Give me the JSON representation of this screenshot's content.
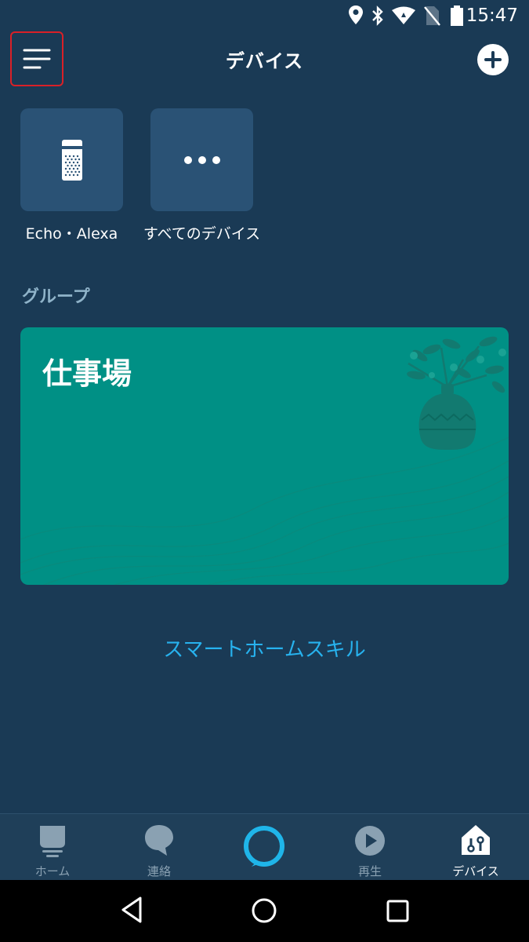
{
  "status_bar": {
    "time": "15:47",
    "icons": [
      "location-icon",
      "bluetooth-icon",
      "wifi-icon",
      "no-sim-icon",
      "battery-icon"
    ]
  },
  "header": {
    "title": "デバイス",
    "menu_icon": "hamburger-menu-icon",
    "add_icon": "plus-icon"
  },
  "device_tiles": [
    {
      "label": "Echo・Alexa",
      "icon": "echo-speaker-icon"
    },
    {
      "label": "すべてのデバイス",
      "icon": "more-dots-icon"
    }
  ],
  "groups": {
    "section_label": "グループ",
    "items": [
      {
        "name": "仕事場",
        "color": "#009085"
      }
    ]
  },
  "smart_home_skill_link": "スマートホームスキル",
  "bottom_nav": {
    "items": [
      {
        "label": "ホーム",
        "icon": "home-icon",
        "active": false
      },
      {
        "label": "連絡",
        "icon": "chat-bubble-icon",
        "active": false
      },
      {
        "label": "",
        "icon": "alexa-ring-icon",
        "active": false
      },
      {
        "label": "再生",
        "icon": "play-icon",
        "active": false
      },
      {
        "label": "デバイス",
        "icon": "devices-house-icon",
        "active": true
      }
    ]
  },
  "android_nav": {
    "icons": [
      "back-icon",
      "home-circle-icon",
      "recents-icon"
    ]
  },
  "colors": {
    "background": "#1a3a55",
    "tile": "#2a5275",
    "group_card": "#009085",
    "link": "#27b2ee",
    "alexa_ring": "#1fb5e9",
    "highlight_border": "#d92027"
  }
}
